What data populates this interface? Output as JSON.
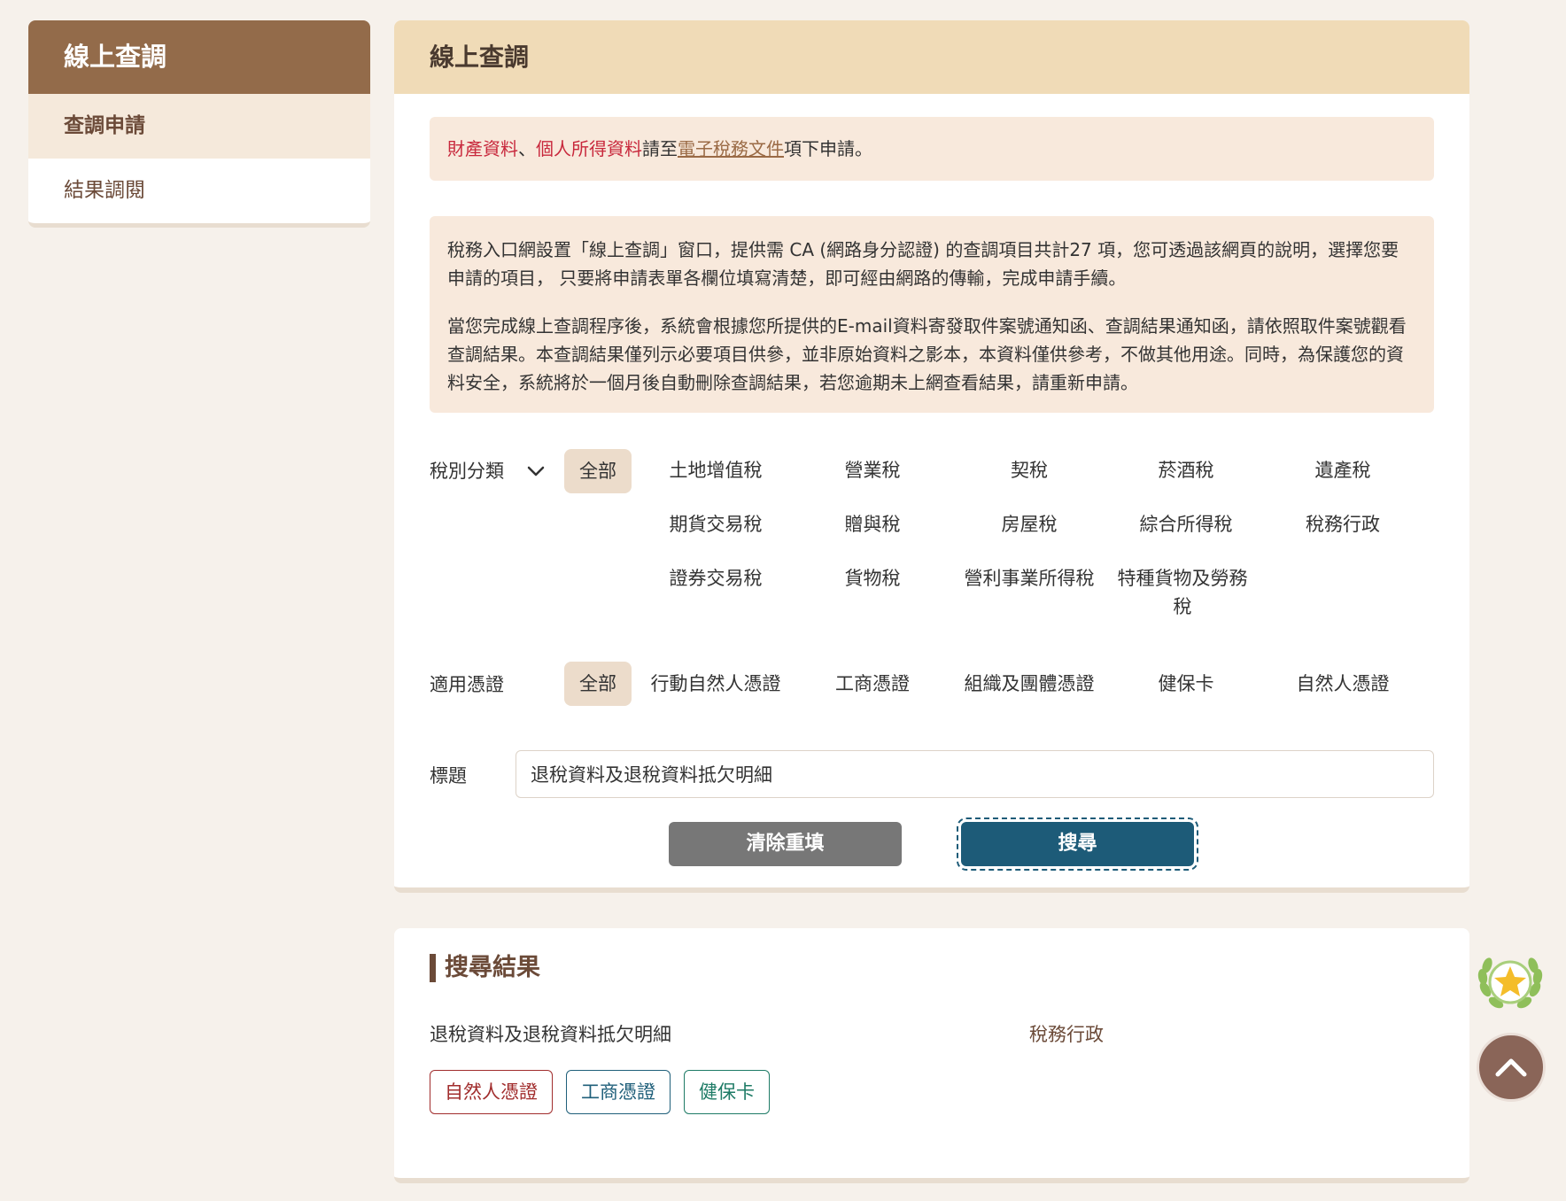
{
  "sidebar": {
    "title": "線上查調",
    "items": [
      {
        "label": "查調申請",
        "active": true
      },
      {
        "label": "結果調閱",
        "active": false
      }
    ]
  },
  "main": {
    "title": "線上查調",
    "notice": {
      "red1": "財產資料",
      "sep": "、",
      "red2": "個人所得資料",
      "mid": "請至",
      "link": "電子稅務文件",
      "tail": "項下申請。"
    },
    "intro": {
      "p1": "稅務入口網設置「線上查調」窗口，提供需 CA (網路身分認證) 的查調項目共計27 項，您可透過該網頁的說明，選擇您要申請的項目， 只要將申請表單各欄位填寫清楚，即可經由網路的傳輸，完成申請手續。",
      "p2": "當您完成線上查調程序後，系統會根據您所提供的E-mail資料寄發取件案號通知函、查調結果通知函，請依照取件案號觀看查調結果。本查調結果僅列示必要項目供參，並非原始資料之影本，本資料僅供參考，不做其他用途。同時，為保護您的資料安全，系統將於一個月後自動刪除查調結果，若您逾期未上網查看結果，請重新申請。"
    },
    "filters": {
      "tax_label": "稅別分類",
      "tax_all": "全部",
      "tax_options": [
        "土地增值稅",
        "營業稅",
        "契稅",
        "菸酒稅",
        "遺產稅",
        "期貨交易稅",
        "贈與稅",
        "房屋稅",
        "綜合所得稅",
        "稅務行政",
        "證券交易稅",
        "貨物稅",
        "營利事業所得稅",
        "特種貨物及勞務稅"
      ],
      "cert_label": "適用憑證",
      "cert_all": "全部",
      "cert_options": [
        "行動自然人憑證",
        "工商憑證",
        "組織及團體憑證",
        "健保卡",
        "自然人憑證"
      ],
      "title_label": "標題",
      "title_value": "退稅資料及退稅資料抵欠明細"
    },
    "buttons": {
      "clear": "清除重填",
      "search": "搜尋"
    }
  },
  "results": {
    "heading": "搜尋結果",
    "items": [
      {
        "name": "退稅資料及退稅資料抵欠明細",
        "category": "稅務行政",
        "tags": [
          "自然人憑證",
          "工商憑證",
          "健保卡"
        ]
      }
    ]
  },
  "colors": {
    "sidebar_head": "#936b4a",
    "main_head": "#f0dbb7",
    "search_button": "#1d5b78",
    "clear_button": "#777777",
    "highlight_red": "#c8283c"
  },
  "icons": {
    "tax_dropdown": "chevron-down-icon",
    "badge": "star-laurel-icon",
    "scroll_top": "chevron-up-icon"
  }
}
